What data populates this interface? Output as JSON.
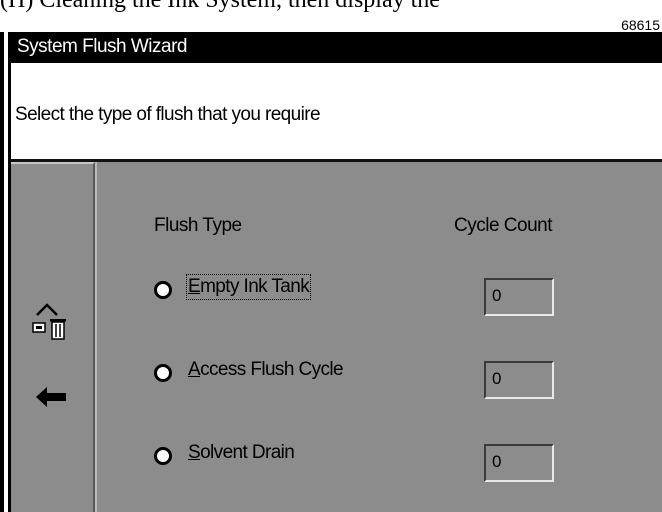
{
  "clipped_text": "(H) Cleaning the Ink System, then display the",
  "figure_number": "68615",
  "window": {
    "title": "System Flush Wizard",
    "prompt": "Select the type of flush that you require"
  },
  "columns": {
    "flush_type": "Flush Type",
    "cycle_count": "Cycle Count"
  },
  "options": [
    {
      "mnemonic": "E",
      "rest": "mpty Ink Tank",
      "count": "0",
      "focused": true
    },
    {
      "mnemonic": "A",
      "rest": "ccess Flush Cycle",
      "count": "0",
      "focused": false
    },
    {
      "mnemonic": "S",
      "rest": "olvent Drain",
      "count": "0",
      "focused": false
    }
  ],
  "icons": {
    "flush": "flush-tank-icon",
    "back": "back-arrow-icon"
  }
}
